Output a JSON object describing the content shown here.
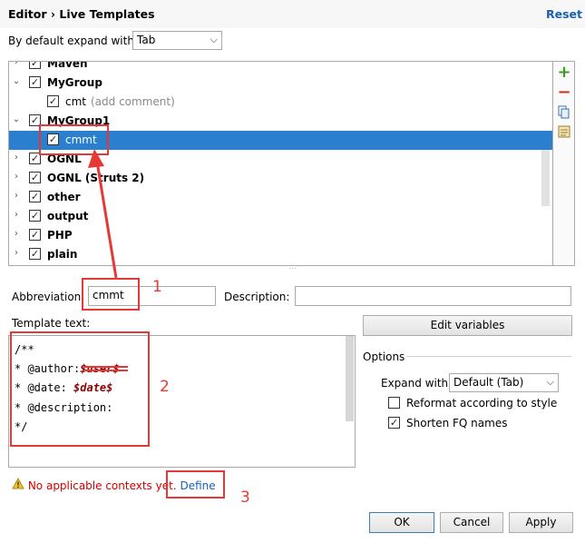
{
  "header": {
    "breadcrumb_editor": "Editor",
    "breadcrumb_sep": "›",
    "breadcrumb_page": "Live Templates",
    "reset_label": "Reset"
  },
  "expand_default": {
    "label": "By default expand with",
    "value": "Tab"
  },
  "tree": {
    "items": [
      {
        "label": "Maven",
        "bold": true,
        "checked": true,
        "expanded": false,
        "level": 0
      },
      {
        "label": "MyGroup",
        "bold": true,
        "checked": true,
        "expanded": true,
        "level": 0
      },
      {
        "label": "cmt",
        "desc": "(add comment)",
        "bold": false,
        "checked": true,
        "level": 1
      },
      {
        "label": "MyGroup1",
        "bold": true,
        "checked": true,
        "expanded": true,
        "level": 0
      },
      {
        "label": "cmmt",
        "bold": false,
        "checked": true,
        "level": 1,
        "selected": true
      },
      {
        "label": "OGNL",
        "bold": true,
        "checked": true,
        "expanded": false,
        "level": 0
      },
      {
        "label": "OGNL (Struts 2)",
        "bold": true,
        "checked": true,
        "expanded": false,
        "level": 0
      },
      {
        "label": "other",
        "bold": true,
        "checked": true,
        "expanded": false,
        "level": 0
      },
      {
        "label": "output",
        "bold": true,
        "checked": true,
        "expanded": false,
        "level": 0
      },
      {
        "label": "PHP",
        "bold": true,
        "checked": true,
        "expanded": false,
        "level": 0
      },
      {
        "label": "plain",
        "bold": true,
        "checked": true,
        "expanded": false,
        "level": 0
      }
    ],
    "tools": [
      "add-icon",
      "remove-icon",
      "copy-icon",
      "template-group-icon"
    ]
  },
  "abbreviation": {
    "label": "Abbreviation:",
    "value": "cmmt"
  },
  "description": {
    "label": "Description:",
    "value": ""
  },
  "template_text": {
    "label": "Template text:",
    "lines": [
      {
        "text": "/**"
      },
      {
        "text": "* @author:",
        "var": "$user$"
      },
      {
        "text": "* @date: ",
        "var": "$date$"
      },
      {
        "text": "* @description:"
      },
      {
        "text": "*/"
      }
    ]
  },
  "edit_variables_label": "Edit variables",
  "options": {
    "title": "Options",
    "expand_with_label": "Expand with",
    "expand_with_value": "Default (Tab)",
    "reformat_label": "Reformat according to style",
    "reformat_checked": false,
    "shorten_label": "Shorten FQ names",
    "shorten_checked": true
  },
  "warning": {
    "text": "No applicable contexts yet.",
    "link": "Define"
  },
  "buttons": {
    "ok": "OK",
    "cancel": "Cancel",
    "apply": "Apply"
  },
  "annotations": {
    "n1": "1",
    "n2": "2",
    "n3": "3",
    "color": "#e53935"
  },
  "colors": {
    "selection": "#2a7fcf",
    "link": "#1a5fb4",
    "warning": "#d40000",
    "variable": "#8b0000"
  }
}
